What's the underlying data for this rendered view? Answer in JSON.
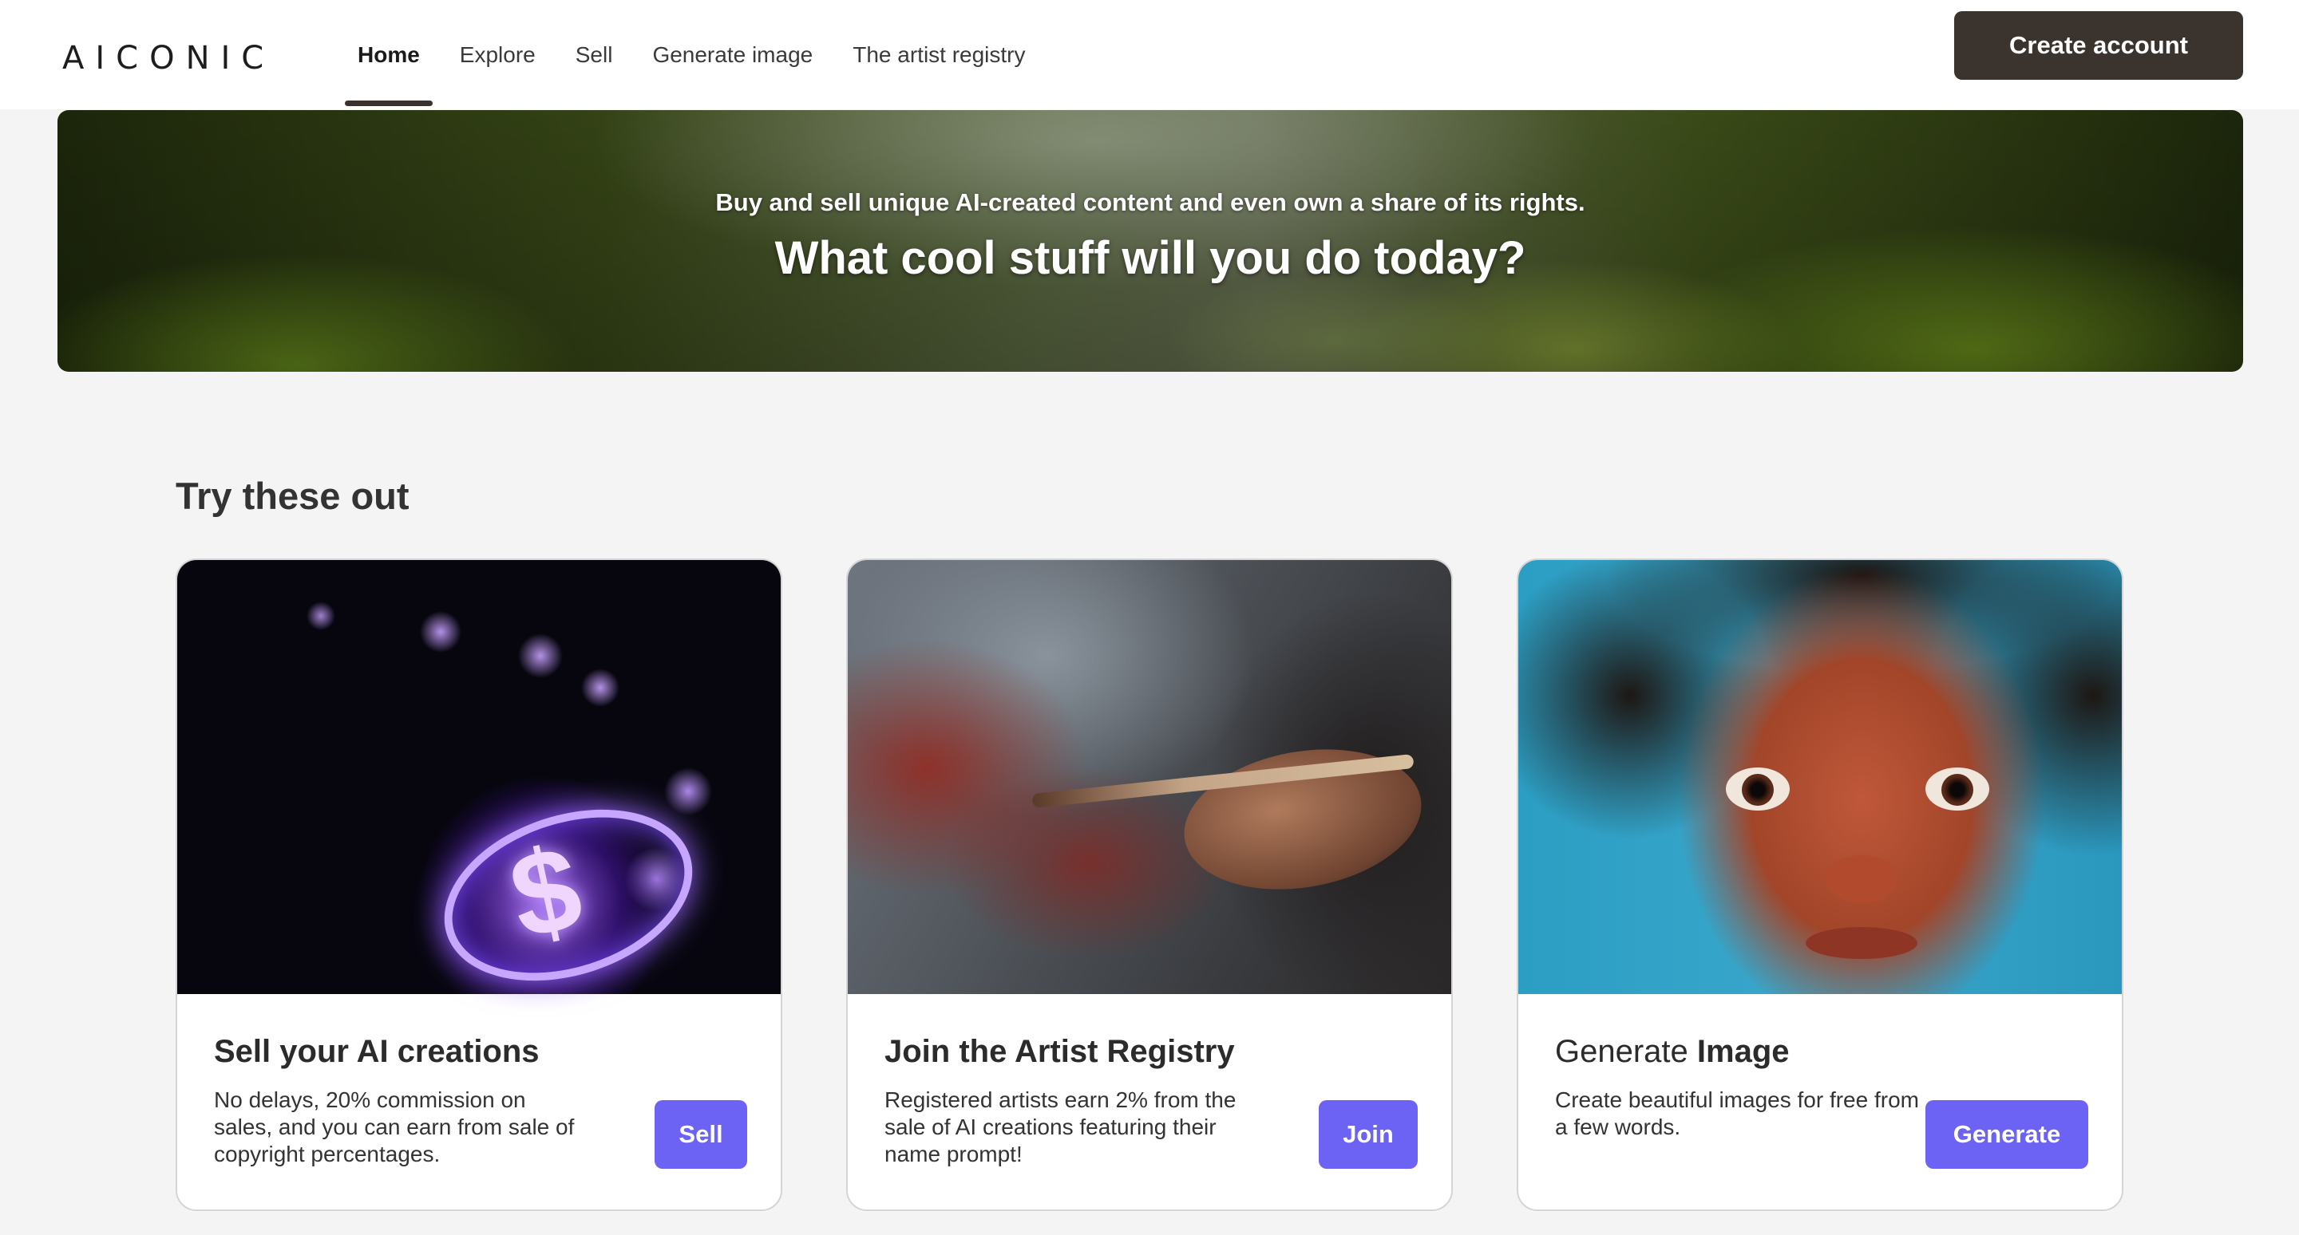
{
  "header": {
    "logo": "AICONIC",
    "nav": [
      "Home",
      "Explore",
      "Sell",
      "Generate image",
      "The artist registry"
    ],
    "active_nav": "Home",
    "create_account": "Create account"
  },
  "hero": {
    "subtitle": "Buy and sell unique AI-created content and even own a share of its rights.",
    "title": "What cool stuff will you do today?"
  },
  "section": {
    "title": "Try these out"
  },
  "cards": [
    {
      "title": "Sell your AI creations",
      "description": "No delays, 20% commission on sales, and you can earn from sale of copyright percentages.",
      "button": "Sell"
    },
    {
      "title": "Join the Artist Registry",
      "description": "Registered artists earn 2% from the sale of AI creations featuring their name prompt!",
      "button": "Join"
    },
    {
      "title_light": "Generate",
      "title_bold": "Image",
      "description": "Create beautiful images for free from a few words.",
      "button": "Generate"
    }
  ],
  "colors": {
    "primary_button": "#6c63f5",
    "dark_button": "#3b342e",
    "background": "#f4f4f4"
  }
}
